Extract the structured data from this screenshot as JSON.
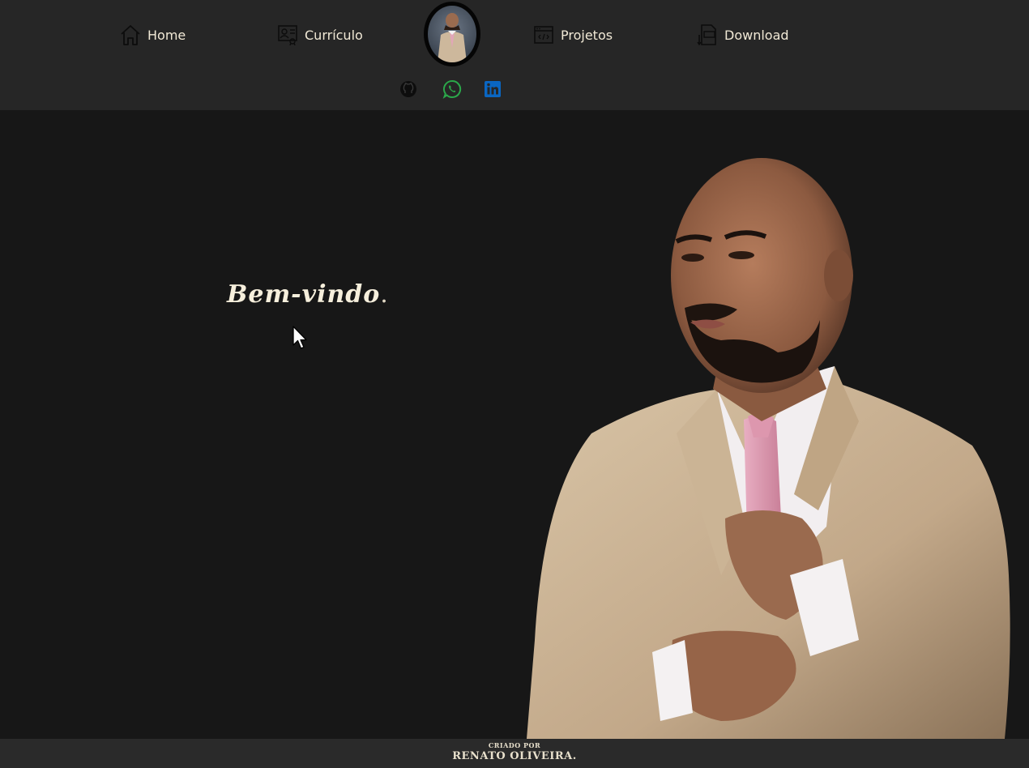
{
  "nav": {
    "home_label": "Home",
    "curriculo_label": "Currículo",
    "projetos_label": "Projetos",
    "download_label": "Download"
  },
  "social": {
    "github_icon": "github-icon",
    "whatsapp_icon": "whatsapp-icon",
    "linkedin_icon": "linkedin-icon",
    "whatsapp_color": "#2ba84a",
    "linkedin_color": "#0a66c2"
  },
  "hero": {
    "welcome_text": "Bem-vindo",
    "welcome_punct": "."
  },
  "footer": {
    "small_text": "CRIADO POR",
    "name_text": "RENATO OLIVEIRA."
  },
  "colors": {
    "background": "#171717",
    "header": "#262626",
    "footer": "#2a2a2a",
    "text": "#f1e9d6"
  }
}
